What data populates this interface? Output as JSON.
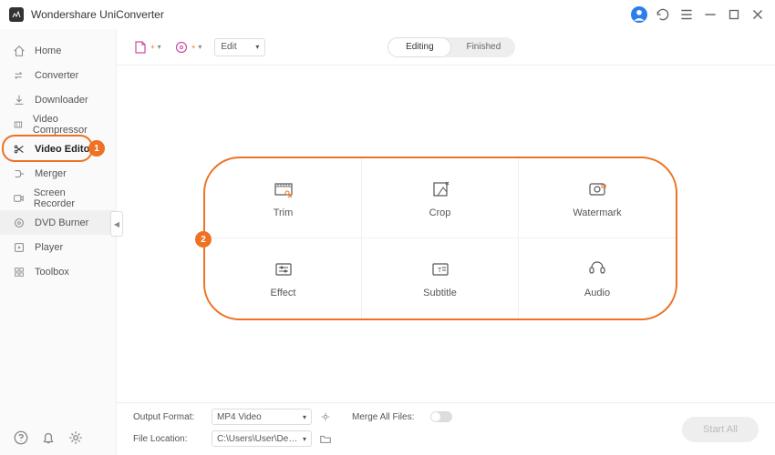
{
  "app": {
    "title": "Wondershare UniConverter"
  },
  "sidebar": {
    "items": [
      {
        "label": "Home"
      },
      {
        "label": "Converter"
      },
      {
        "label": "Downloader"
      },
      {
        "label": "Video Compressor"
      },
      {
        "label": "Video Editor"
      },
      {
        "label": "Merger"
      },
      {
        "label": "Screen Recorder"
      },
      {
        "label": "DVD Burner"
      },
      {
        "label": "Player"
      },
      {
        "label": "Toolbox"
      }
    ]
  },
  "toolbar": {
    "edit_label": "Edit",
    "seg_editing": "Editing",
    "seg_finished": "Finished"
  },
  "tools": [
    {
      "label": "Trim"
    },
    {
      "label": "Crop"
    },
    {
      "label": "Watermark"
    },
    {
      "label": "Effect"
    },
    {
      "label": "Subtitle"
    },
    {
      "label": "Audio"
    }
  ],
  "footer": {
    "output_format_label": "Output Format:",
    "output_format_value": "MP4 Video",
    "file_location_label": "File Location:",
    "file_location_value": "C:\\Users\\User\\Desktop",
    "merge_label": "Merge All Files:",
    "start_label": "Start All"
  },
  "annotations": {
    "one": "1",
    "two": "2"
  }
}
